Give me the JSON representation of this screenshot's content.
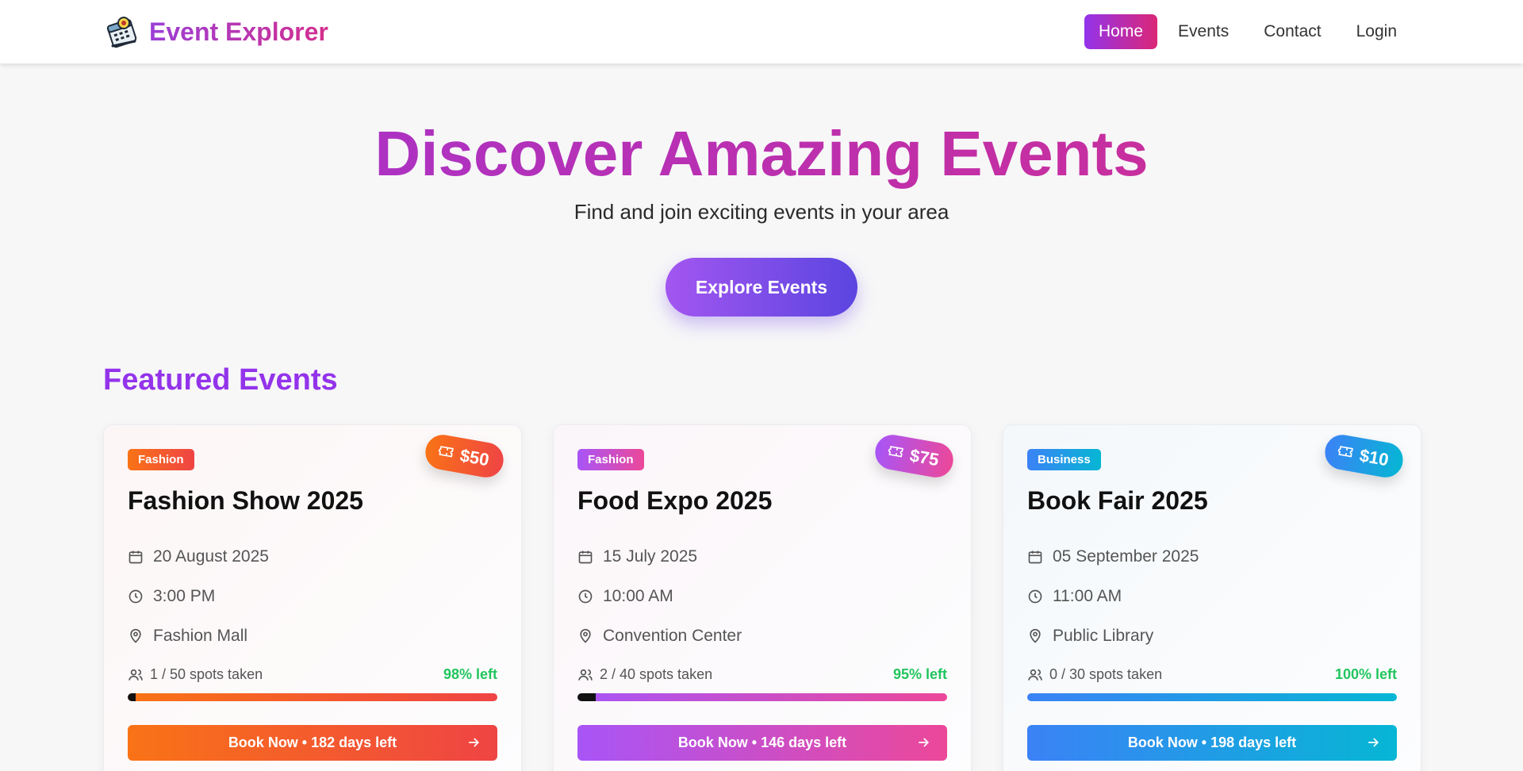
{
  "brand": {
    "name": "Event Explorer",
    "icon": "calendar-ticket-logo"
  },
  "nav": {
    "items": [
      {
        "label": "Home",
        "active": true
      },
      {
        "label": "Events",
        "active": false
      },
      {
        "label": "Contact",
        "active": false
      },
      {
        "label": "Login",
        "active": false
      }
    ]
  },
  "hero": {
    "title": "Discover Amazing Events",
    "subtitle": "Find and join exciting events in your area",
    "cta": "Explore Events"
  },
  "featured": {
    "title": "Featured Events",
    "cards": [
      {
        "category": "Fashion",
        "price": "$50",
        "title": "Fashion Show 2025",
        "date": "20 August 2025",
        "time": "3:00 PM",
        "location": "Fashion Mall",
        "spots": "1 / 50 spots taken",
        "left": "98% left",
        "taken_fraction": 0.02,
        "book": "Book Now • 182 days left",
        "colors": {
          "from": "#f97316",
          "to": "#ef4444",
          "bg": "#fdf6f6"
        }
      },
      {
        "category": "Fashion",
        "price": "$75",
        "title": "Food Expo 2025",
        "date": "15 July 2025",
        "time": "10:00 AM",
        "location": "Convention Center",
        "spots": "2 / 40 spots taken",
        "left": "95% left",
        "taken_fraction": 0.05,
        "book": "Book Now • 146 days left",
        "colors": {
          "from": "#a855f7",
          "to": "#ec4899",
          "bg": "#fbf6f9"
        }
      },
      {
        "category": "Business",
        "price": "$10",
        "title": "Book Fair 2025",
        "date": "05 September 2025",
        "time": "11:00 AM",
        "location": "Public Library",
        "spots": "0 / 30 spots taken",
        "left": "100% left",
        "taken_fraction": 0,
        "book": "Book Now • 198 days left",
        "colors": {
          "from": "#3b82f6",
          "to": "#06b6d4",
          "bg": "#f4f8fb"
        }
      }
    ]
  }
}
